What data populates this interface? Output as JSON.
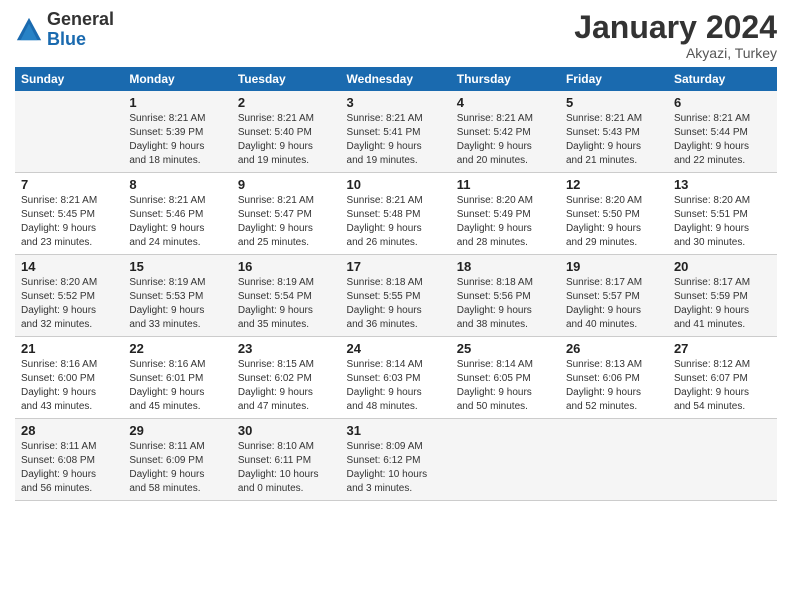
{
  "header": {
    "logo_general": "General",
    "logo_blue": "Blue",
    "month": "January 2024",
    "location": "Akyazi, Turkey"
  },
  "days_of_week": [
    "Sunday",
    "Monday",
    "Tuesday",
    "Wednesday",
    "Thursday",
    "Friday",
    "Saturday"
  ],
  "weeks": [
    [
      {
        "day": "",
        "info": ""
      },
      {
        "day": "1",
        "info": "Sunrise: 8:21 AM\nSunset: 5:39 PM\nDaylight: 9 hours\nand 18 minutes."
      },
      {
        "day": "2",
        "info": "Sunrise: 8:21 AM\nSunset: 5:40 PM\nDaylight: 9 hours\nand 19 minutes."
      },
      {
        "day": "3",
        "info": "Sunrise: 8:21 AM\nSunset: 5:41 PM\nDaylight: 9 hours\nand 19 minutes."
      },
      {
        "day": "4",
        "info": "Sunrise: 8:21 AM\nSunset: 5:42 PM\nDaylight: 9 hours\nand 20 minutes."
      },
      {
        "day": "5",
        "info": "Sunrise: 8:21 AM\nSunset: 5:43 PM\nDaylight: 9 hours\nand 21 minutes."
      },
      {
        "day": "6",
        "info": "Sunrise: 8:21 AM\nSunset: 5:44 PM\nDaylight: 9 hours\nand 22 minutes."
      }
    ],
    [
      {
        "day": "7",
        "info": "Sunrise: 8:21 AM\nSunset: 5:45 PM\nDaylight: 9 hours\nand 23 minutes."
      },
      {
        "day": "8",
        "info": "Sunrise: 8:21 AM\nSunset: 5:46 PM\nDaylight: 9 hours\nand 24 minutes."
      },
      {
        "day": "9",
        "info": "Sunrise: 8:21 AM\nSunset: 5:47 PM\nDaylight: 9 hours\nand 25 minutes."
      },
      {
        "day": "10",
        "info": "Sunrise: 8:21 AM\nSunset: 5:48 PM\nDaylight: 9 hours\nand 26 minutes."
      },
      {
        "day": "11",
        "info": "Sunrise: 8:20 AM\nSunset: 5:49 PM\nDaylight: 9 hours\nand 28 minutes."
      },
      {
        "day": "12",
        "info": "Sunrise: 8:20 AM\nSunset: 5:50 PM\nDaylight: 9 hours\nand 29 minutes."
      },
      {
        "day": "13",
        "info": "Sunrise: 8:20 AM\nSunset: 5:51 PM\nDaylight: 9 hours\nand 30 minutes."
      }
    ],
    [
      {
        "day": "14",
        "info": "Sunrise: 8:20 AM\nSunset: 5:52 PM\nDaylight: 9 hours\nand 32 minutes."
      },
      {
        "day": "15",
        "info": "Sunrise: 8:19 AM\nSunset: 5:53 PM\nDaylight: 9 hours\nand 33 minutes."
      },
      {
        "day": "16",
        "info": "Sunrise: 8:19 AM\nSunset: 5:54 PM\nDaylight: 9 hours\nand 35 minutes."
      },
      {
        "day": "17",
        "info": "Sunrise: 8:18 AM\nSunset: 5:55 PM\nDaylight: 9 hours\nand 36 minutes."
      },
      {
        "day": "18",
        "info": "Sunrise: 8:18 AM\nSunset: 5:56 PM\nDaylight: 9 hours\nand 38 minutes."
      },
      {
        "day": "19",
        "info": "Sunrise: 8:17 AM\nSunset: 5:57 PM\nDaylight: 9 hours\nand 40 minutes."
      },
      {
        "day": "20",
        "info": "Sunrise: 8:17 AM\nSunset: 5:59 PM\nDaylight: 9 hours\nand 41 minutes."
      }
    ],
    [
      {
        "day": "21",
        "info": "Sunrise: 8:16 AM\nSunset: 6:00 PM\nDaylight: 9 hours\nand 43 minutes."
      },
      {
        "day": "22",
        "info": "Sunrise: 8:16 AM\nSunset: 6:01 PM\nDaylight: 9 hours\nand 45 minutes."
      },
      {
        "day": "23",
        "info": "Sunrise: 8:15 AM\nSunset: 6:02 PM\nDaylight: 9 hours\nand 47 minutes."
      },
      {
        "day": "24",
        "info": "Sunrise: 8:14 AM\nSunset: 6:03 PM\nDaylight: 9 hours\nand 48 minutes."
      },
      {
        "day": "25",
        "info": "Sunrise: 8:14 AM\nSunset: 6:05 PM\nDaylight: 9 hours\nand 50 minutes."
      },
      {
        "day": "26",
        "info": "Sunrise: 8:13 AM\nSunset: 6:06 PM\nDaylight: 9 hours\nand 52 minutes."
      },
      {
        "day": "27",
        "info": "Sunrise: 8:12 AM\nSunset: 6:07 PM\nDaylight: 9 hours\nand 54 minutes."
      }
    ],
    [
      {
        "day": "28",
        "info": "Sunrise: 8:11 AM\nSunset: 6:08 PM\nDaylight: 9 hours\nand 56 minutes."
      },
      {
        "day": "29",
        "info": "Sunrise: 8:11 AM\nSunset: 6:09 PM\nDaylight: 9 hours\nand 58 minutes."
      },
      {
        "day": "30",
        "info": "Sunrise: 8:10 AM\nSunset: 6:11 PM\nDaylight: 10 hours\nand 0 minutes."
      },
      {
        "day": "31",
        "info": "Sunrise: 8:09 AM\nSunset: 6:12 PM\nDaylight: 10 hours\nand 3 minutes."
      },
      {
        "day": "",
        "info": ""
      },
      {
        "day": "",
        "info": ""
      },
      {
        "day": "",
        "info": ""
      }
    ]
  ]
}
